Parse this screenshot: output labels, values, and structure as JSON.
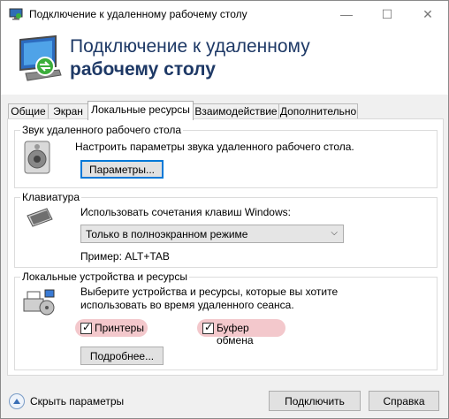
{
  "window": {
    "title": "Подключение к удаленному рабочему столу",
    "header_line1": "Подключение к удаленному",
    "header_line2": "рабочему столу",
    "minimize": "—",
    "maximize": "☐",
    "close": "✕"
  },
  "tabs": [
    {
      "label": "Общие"
    },
    {
      "label": "Экран"
    },
    {
      "label": "Локальные ресурсы",
      "active": true
    },
    {
      "label": "Взаимодействие"
    },
    {
      "label": "Дополнительно"
    }
  ],
  "sound": {
    "group_label": "Звук удаленного рабочего стола",
    "description": "Настроить параметры звука удаленного рабочего стола.",
    "params_button": "Параметры..."
  },
  "keyboard": {
    "group_label": "Клавиатура",
    "description": "Использовать сочетания клавиш Windows:",
    "selected": "Только в полноэкранном режиме",
    "example": "Пример: ALT+TAB"
  },
  "devices": {
    "group_label": "Локальные устройства и ресурсы",
    "description_line1": "Выберите устройства и ресурсы, которые вы хотите",
    "description_line2": "использовать во время удаленного сеанса.",
    "printers_label": "Принтеры",
    "printers_checked": true,
    "clipboard_label": "Буфер обмена",
    "clipboard_checked": true,
    "more_button": "Подробнее..."
  },
  "footer": {
    "hide_options": "Скрыть параметры",
    "connect_button": "Подключить",
    "help_button": "Справка"
  },
  "colors": {
    "header_text": "#1e3966",
    "highlight": "#f3c8cc",
    "focus": "#0078d7"
  }
}
